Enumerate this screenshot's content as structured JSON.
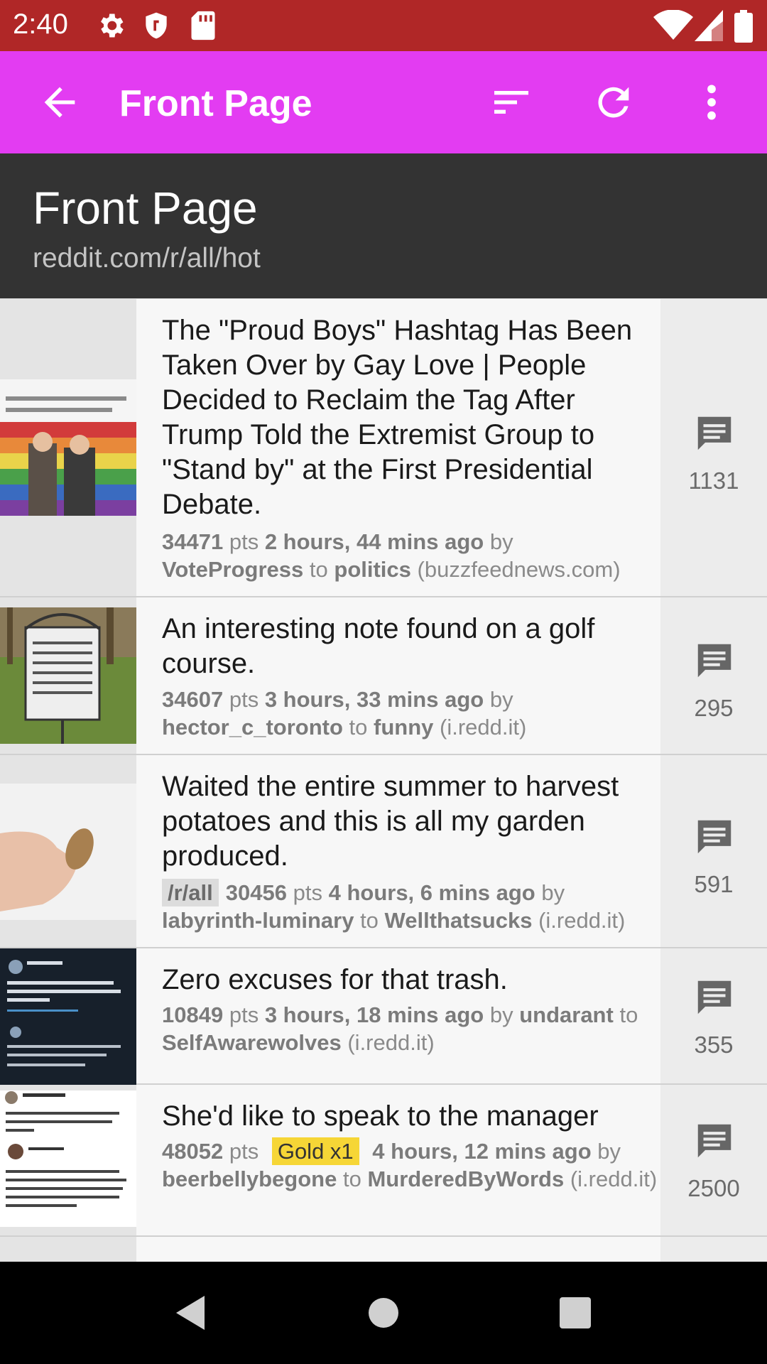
{
  "status_bar": {
    "time": "2:40",
    "icons": [
      "gear-icon",
      "shield-icon",
      "sd-card-icon",
      "wifi-icon",
      "cell-signal-icon",
      "battery-icon"
    ]
  },
  "app_bar": {
    "title": "Front Page",
    "color": "#e33cf2",
    "icons": [
      "back-arrow-icon",
      "sort-icon",
      "refresh-icon",
      "more-vert-icon"
    ]
  },
  "header": {
    "title": "Front Page",
    "subtitle": "reddit.com/r/all/hot"
  },
  "labels": {
    "pts": "pts",
    "by": "by",
    "to": "to"
  },
  "posts": [
    {
      "title": "The \"Proud Boys\" Hashtag Has Been Taken Over by Gay Love | People Decided to Reclaim the Tag After Trump Told the Extremist Group to \"Stand by\" at the First Presidential Debate.",
      "points": "34471",
      "age": "2 hours, 44 mins ago",
      "author": "VoteProgress",
      "subreddit": "politics",
      "domain": "(buzzfeednews.com)",
      "comments": "1131"
    },
    {
      "title": "An interesting note found on a golf course.",
      "points": "34607",
      "age": "3 hours, 33 mins ago",
      "author": "hector_c_toronto",
      "subreddit": "funny",
      "domain": "(i.redd.it)",
      "comments": "295"
    },
    {
      "title": "Waited the entire summer to harvest potatoes and this is all my garden produced.",
      "badge": "/r/all",
      "points": "30456",
      "age": "4 hours, 6 mins ago",
      "author": "labyrinth-luminary",
      "subreddit": "Wellthatsucks",
      "domain": "(i.redd.it)",
      "comments": "591"
    },
    {
      "title": "Zero excuses for that trash.",
      "points": "10849",
      "age": "3 hours, 18 mins ago",
      "author": "undarant",
      "subreddit": "SelfAwarewolves",
      "domain": "(i.redd.it)",
      "comments": "355"
    },
    {
      "title": "She'd like to speak to the manager",
      "points": "48052",
      "gold": "Gold x1",
      "age": "4 hours, 12 mins ago",
      "author": "beerbellybegone",
      "subreddit": "MurderedByWords",
      "domain": "(i.redd.it)",
      "comments": "2500"
    }
  ],
  "nav_bar": {
    "icons": [
      "back-triangle-icon",
      "home-circle-icon",
      "recents-square-icon"
    ]
  }
}
